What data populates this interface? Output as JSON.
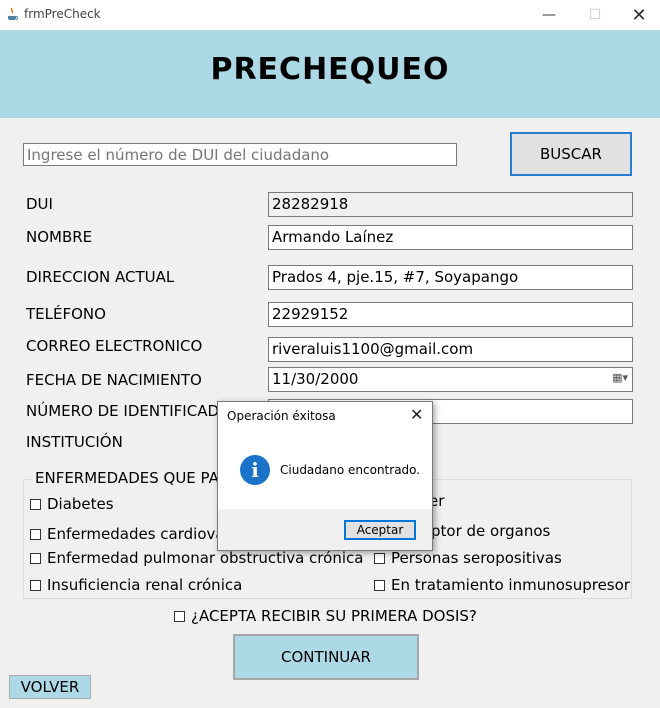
{
  "window": {
    "title": "frmPreCheck",
    "min_icon": "minimize-icon",
    "max_icon": "maximize-icon",
    "close_icon": "close-icon"
  },
  "header": {
    "title": "PRECHEQUEO",
    "bg_color": "#add8e6"
  },
  "search": {
    "placeholder": "Ingrese el número de DUI del ciudadano",
    "value": "",
    "button_label": "BUSCAR"
  },
  "form": {
    "dui": {
      "label": "DUI",
      "value": "28282918"
    },
    "nombre": {
      "label": "NOMBRE",
      "value": "Armando Laínez"
    },
    "direccion": {
      "label": "DIRECCION ACTUAL",
      "value": "Prados 4, pje.15, #7, Soyapango"
    },
    "telefono": {
      "label": "TELÉFONO",
      "value": "22929152"
    },
    "correo": {
      "label": "CORREO ELECTRONICO",
      "value": "riveraluis1100@gmail.com"
    },
    "fecha": {
      "label": "FECHA DE NACIMIENTO",
      "value": "11/30/2000"
    },
    "numero": {
      "label": "NÚMERO DE IDENTIFICAD",
      "value": ""
    },
    "institucion": {
      "label": "INSTITUCIÓN"
    }
  },
  "enfermedades": {
    "title": "ENFERMEDADES QUE PAD",
    "left": [
      {
        "label": "Diabetes",
        "checked": false
      },
      {
        "label": "Enfermedades cardiova",
        "checked": false
      },
      {
        "label": "Enfermedad pulmonar obstructiva crónica",
        "checked": false
      },
      {
        "label": "Insuficiencia renal crónica",
        "checked": false
      }
    ],
    "right": [
      {
        "label": "er",
        "checked": false
      },
      {
        "label": "ptor de organos",
        "checked": false
      },
      {
        "label": "Personas seropositivas",
        "checked": false
      },
      {
        "label": "En tratamiento inmunosupresor",
        "checked": false
      }
    ]
  },
  "acepta": {
    "label": "¿ACEPTA RECIBIR SU PRIMERA DOSIS?",
    "checked": false
  },
  "buttons": {
    "continuar": "CONTINUAR",
    "volver": "VOLVER"
  },
  "dialog": {
    "title": "Operación éxitosa",
    "message": "Ciudadano encontrado.",
    "ok_label": "Aceptar",
    "icon": "info-icon",
    "icon_color": "#1a73c8"
  }
}
